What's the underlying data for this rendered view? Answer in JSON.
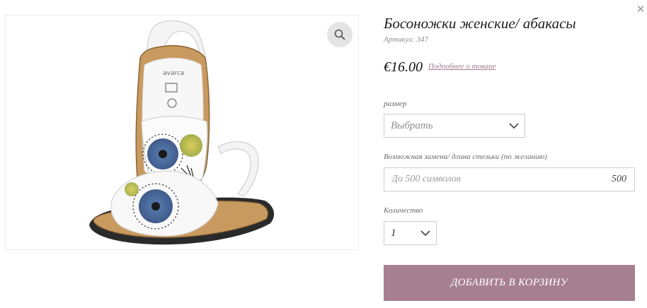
{
  "product": {
    "title": "Босоножки женские/ абакасы",
    "sku": "Артикул: 347",
    "price": "€16.00",
    "details_link": "Подробнее о товаре",
    "image_name": "sandals-photo"
  },
  "options": {
    "size_label": "размер",
    "size_value": "Выбрать",
    "note_label": "Возможная замена/ длина стельки (по желанию)",
    "note_placeholder": "До 500 символов",
    "note_counter": "500",
    "qty_label": "Количество",
    "qty_value": "1"
  },
  "actions": {
    "add_to_cart": "ДОБАВИТЬ В КОРЗИНУ"
  },
  "icons": {
    "close": "close-icon",
    "zoom": "search-icon",
    "dropdown": "chevron-down-icon"
  },
  "colors": {
    "accent": "#a67f91",
    "link": "#a47a8d",
    "border": "#cccccc"
  }
}
